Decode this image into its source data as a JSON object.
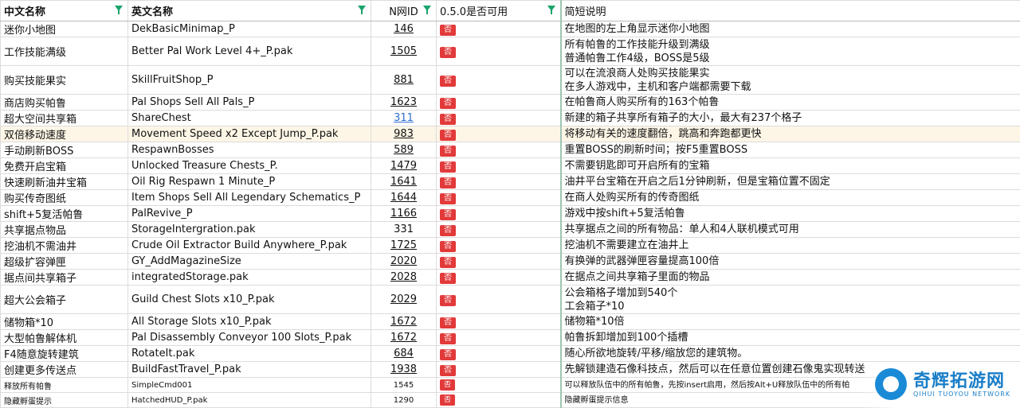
{
  "headers": {
    "cn": "中文名称",
    "en": "英文名称",
    "nid": "N网ID",
    "usable": "0.5.0是否可用",
    "desc": "简短说明"
  },
  "badge_text": "否",
  "accent_colors": {
    "filter": "#1aa36b",
    "badge": "#e23a3a",
    "link": "#2f6fd1"
  },
  "rows": [
    {
      "cn": "迷你小地图",
      "en": "DekBasicMinimap_P",
      "nid": "146",
      "usable": "否",
      "desc": [
        "在地图的左上角显示迷你小地图"
      ]
    },
    {
      "cn": "工作技能满级",
      "en": "Better Pal Work Level 4+_P.pak",
      "nid": "1505",
      "usable": "否",
      "desc": [
        "所有帕鲁的工作技能升级到满级",
        "普通帕鲁工作4级，BOSS是5级"
      ]
    },
    {
      "cn": "购买技能果实",
      "en": "SkillFruitShop_P",
      "nid": "881",
      "usable": "否",
      "desc": [
        "可以在流浪商人处购买技能果实",
        "在多人游戏中，主机和客户端都需要下载"
      ]
    },
    {
      "cn": "商店购买帕鲁",
      "en": "Pal Shops Sell All Pals_P",
      "nid": "1623",
      "usable": "否",
      "desc": [
        "在帕鲁商人购买所有的163个帕鲁"
      ]
    },
    {
      "cn": "超大空间共享箱",
      "en": "ShareChest",
      "nid": "311",
      "usable": "否",
      "desc": [
        "新建的箱子共享所有箱子的大小，最大有237个格子"
      ]
    },
    {
      "cn": "双倍移动速度",
      "en": "Movement Speed x2 Except Jump_P.pak",
      "nid": "983",
      "usable": "否",
      "desc": [
        "将移动有关的速度翻倍，跳高和奔跑都更快"
      ]
    },
    {
      "cn": "手动刷新BOSS",
      "en": "RespawnBosses",
      "nid": "589",
      "usable": "否",
      "desc": [
        "重置BOSS的刷新时间；按F5重置BOSS"
      ]
    },
    {
      "cn": "免费开启宝箱",
      "en": "Unlocked Treasure Chests_P.",
      "nid": "1479",
      "usable": "否",
      "desc": [
        "不需要钥匙即可开启所有的宝箱"
      ]
    },
    {
      "cn": "快速刷新油井宝箱",
      "en": "Oil Rig Respawn 1 Minute_P",
      "nid": "1641",
      "usable": "否",
      "desc": [
        "油井平台宝箱在开启之后1分钟刷新，但是宝箱位置不固定"
      ]
    },
    {
      "cn": "购买传奇图纸",
      "en": "Item Shops Sell All Legendary Schematics_P",
      "nid": "1644",
      "usable": "否",
      "desc": [
        "在商人处购买所有的传奇图纸"
      ]
    },
    {
      "cn": "shift+5复活帕鲁",
      "en": "PalRevive_P",
      "nid": "1166",
      "usable": "否",
      "desc": [
        "游戏中按shift+5复活帕鲁"
      ]
    },
    {
      "cn": "共享据点物品",
      "en": "StorageIntergration.pak",
      "nid": "331",
      "usable": "否",
      "desc": [
        "共享据点之间的所有物品：单人和4人联机模式可用"
      ]
    },
    {
      "cn": "挖油机不需油井",
      "en": "Crude Oil Extractor Build Anywhere_P.pak",
      "nid": "1725",
      "usable": "否",
      "desc": [
        "挖油机不需要建立在油井上"
      ]
    },
    {
      "cn": "超级扩容弹匣",
      "en": "GY_AddMagazineSize",
      "nid": "2020",
      "usable": "否",
      "desc": [
        "有换弹的武器弹匣容量提高100倍"
      ]
    },
    {
      "cn": "据点间共享箱子",
      "en": "integratedStorage.pak",
      "nid": "2028",
      "usable": "否",
      "desc": [
        "在据点之间共享箱子里面的物品"
      ]
    },
    {
      "cn": "超大公会箱子",
      "en": "Guild Chest Slots x10_P.pak",
      "nid": "2029",
      "usable": "否",
      "desc": [
        "公会箱格子增加到540个",
        "工会箱子*10"
      ]
    },
    {
      "cn": "储物箱*10",
      "en": "All Storage Slots x10_P.pak",
      "nid": "1672",
      "usable": "否",
      "desc": [
        "储物箱*10倍"
      ]
    },
    {
      "cn": "大型帕鲁解体机",
      "en": "Pal Disassembly Conveyor 100 Slots_P.pak",
      "nid": "1672",
      "usable": "否",
      "desc": [
        "帕鲁拆卸增加到100个插槽"
      ]
    },
    {
      "cn": "F4随意旋转建筑",
      "en": "RotateIt.pak",
      "nid": "684",
      "usable": "否",
      "desc": [
        "随心所欲地旋转/平移/缩放您的建筑物。"
      ]
    },
    {
      "cn": "创建更多传送点",
      "en": "BuildFastTravel_P.pak",
      "nid": "1938",
      "usable": "否",
      "desc": [
        "先解锁建造石像科技点，然后可以在任意位置创建石像鬼实现转送"
      ]
    },
    {
      "cn": "释放所有帕鲁",
      "en": "SimpleCmd001",
      "nid": "1545",
      "usable": "否",
      "desc": [
        "可以释放队伍中的所有帕鲁，先按insert启用，然后按Alt+U释放队伍中的所有帕"
      ]
    },
    {
      "cn": "隐藏孵蛋提示",
      "en": "HatchedHUD_P.pak",
      "nid": "1290",
      "usable": "否",
      "desc": [
        "隐藏孵蛋提示信息"
      ]
    }
  ],
  "watermark": {
    "title": "奇辉拓游网",
    "subtitle": "QIHUI TUOYOU NETWORK"
  }
}
